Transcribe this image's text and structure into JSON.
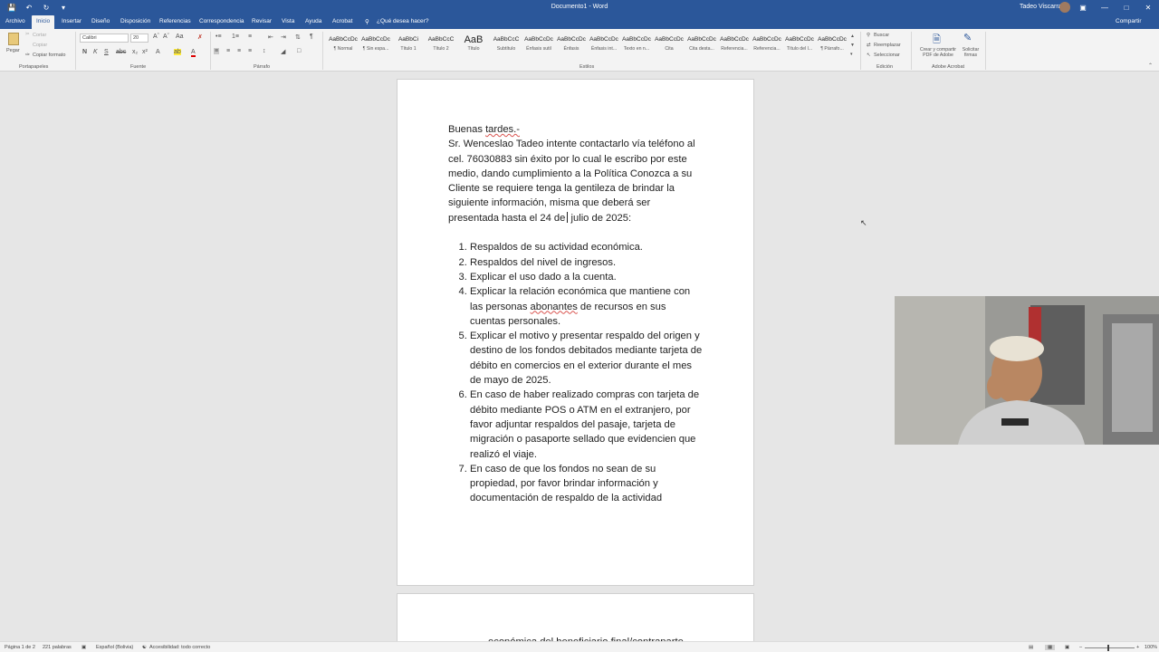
{
  "titlebar": {
    "doc_title": "Documento1 - Word",
    "user": "Tadeo Viscarra",
    "win_controls": [
      "—",
      "□",
      "✕"
    ]
  },
  "tabs": [
    "Archivo",
    "Inicio",
    "Insertar",
    "Diseño",
    "Disposición",
    "Referencias",
    "Correspondencia",
    "Revisar",
    "Vista",
    "Ayuda",
    "Acrobat",
    "¿Qué desea hacer?"
  ],
  "share_label": "Compartir",
  "ribbon": {
    "clipboard": {
      "paste": "Pegar",
      "cut": "Cortar",
      "copy": "Copiar",
      "format_painter": "Copiar formato",
      "label": "Portapapeles"
    },
    "font": {
      "family": "Calibri",
      "size": "20",
      "label": "Fuente"
    },
    "paragraph_label": "Párrafo",
    "styles": [
      {
        "sample": "AaBbCcDc",
        "name": "¶ Normal"
      },
      {
        "sample": "AaBbCcDc",
        "name": "¶ Sin espa..."
      },
      {
        "sample": "AaBbCi",
        "name": "Título 1"
      },
      {
        "sample": "AaBbCcC",
        "name": "Título 2"
      },
      {
        "sample": "AaB",
        "name": "Título"
      },
      {
        "sample": "AaBbCcC",
        "name": "Subtítulo"
      },
      {
        "sample": "AaBbCcDc",
        "name": "Énfasis sutil"
      },
      {
        "sample": "AaBbCcDc",
        "name": "Énfasis"
      },
      {
        "sample": "AaBbCcDc",
        "name": "Énfasis int..."
      },
      {
        "sample": "AaBbCcDc",
        "name": "Texto en n..."
      },
      {
        "sample": "AaBbCcDc",
        "name": "Cita"
      },
      {
        "sample": "AaBbCcDc",
        "name": "Cita desta..."
      },
      {
        "sample": "AaBbCcDc",
        "name": "Referencia..."
      },
      {
        "sample": "AaBbCcDc",
        "name": "Referencia..."
      },
      {
        "sample": "AaBbCcDc",
        "name": "Título del l..."
      },
      {
        "sample": "AaBbCcDc",
        "name": "¶ Párrafo..."
      }
    ],
    "styles_label": "Estilos",
    "editing": {
      "find": "Buscar",
      "replace": "Reemplazar",
      "select": "Seleccionar",
      "label": "Edición"
    },
    "acrobat": {
      "create": "Crear y compartir PDF de Adobe",
      "sign": "Solicitar firmas",
      "label": "Adobe Acrobat"
    }
  },
  "document": {
    "greeting_pre": "Buenas ",
    "greeting_word": "tardes.-",
    "body": "Sr. Wenceslao Tadeo intente contactarlo vía teléfono al cel. 76030883 sin éxito por lo cual le escribo por este medio, dando cumplimiento a la Política Conozca a su Cliente se requiere tenga la gentileza de brindar la siguiente información, misma que deberá ser presentada hasta el 24 de",
    "body_end": "julio de 2025:",
    "items": [
      "Respaldos de su actividad económica.",
      "Respaldos del nivel de ingresos.",
      "Explicar el uso dado a la cuenta.",
      "Explicar la relación económica que mantiene con las personas abonantes de recursos en sus cuentas personales.",
      "Explicar el motivo y presentar respaldo del origen y destino de los fondos debitados mediante tarjeta de débito en comercios en el exterior durante el mes de mayo de 2025.",
      "En caso de haber realizado compras con tarjeta de débito mediante POS o ATM en el extranjero, por favor adjuntar respaldos del pasaje, tarjeta de migración o pasaporte sellado que evidencien que realizó el viaje.",
      "En caso de que los fondos no sean de su propiedad, por favor brindar información y documentación de respaldo de la actividad"
    ],
    "page2_partial": "económica del beneficiario final/contraparte"
  },
  "status": {
    "page": "Página 1 de 2",
    "words": "221 palabras",
    "language": "Español (Bolivia)",
    "accessibility": "Accesibilidad: todo correcto",
    "zoom": "100%"
  }
}
